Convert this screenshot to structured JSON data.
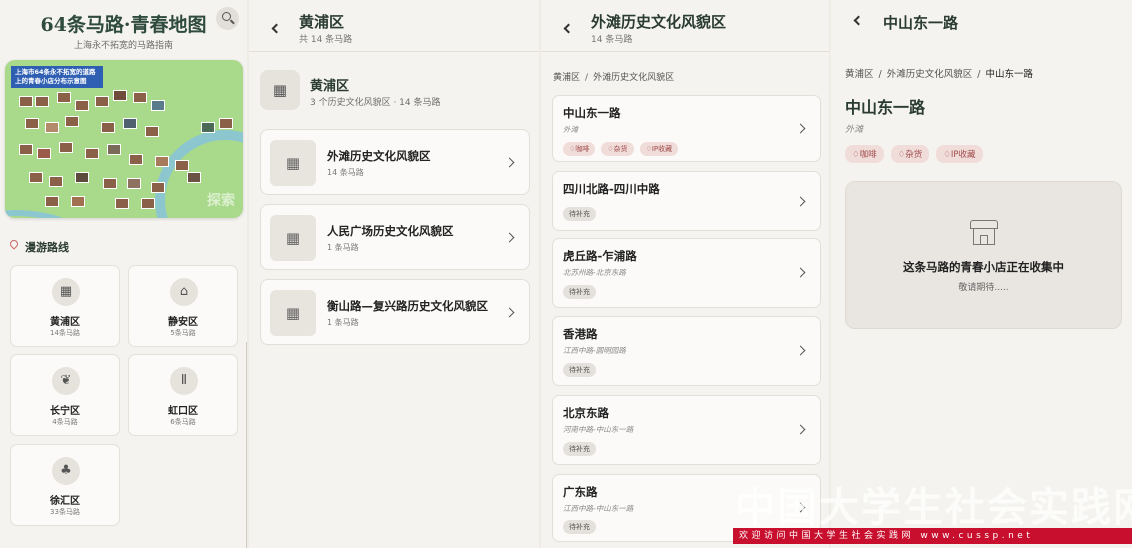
{
  "home": {
    "title": "64条马路·青春地图",
    "subtitle": "上海永不拓宽的马路指南",
    "map_tag": "上海市64条永不拓宽的道路上的青春小店分布示意图",
    "map_watermark": "探索",
    "section_title": "漫游路线",
    "districts": [
      {
        "name": "黄浦区",
        "count": "14条马路",
        "icon": "building-icon"
      },
      {
        "name": "静安区",
        "count": "5条马路",
        "icon": "home-icon"
      },
      {
        "name": "长宁区",
        "count": "4条马路",
        "icon": "leaf-icon"
      },
      {
        "name": "虹口区",
        "count": "6条马路",
        "icon": "pillar-icon"
      },
      {
        "name": "徐汇区",
        "count": "33条马路",
        "icon": "tree-icon"
      }
    ]
  },
  "district": {
    "header_title": "黄浦区",
    "header_sub": "共 14 条马路",
    "title": "黄浦区",
    "summary": "3 个历史文化风貌区 · 14 条马路",
    "areas": [
      {
        "name": "外滩历史文化风貌区",
        "count": "14 条马路"
      },
      {
        "name": "人民广场历史文化风貌区",
        "count": "1 条马路"
      },
      {
        "name": "衡山路—复兴路历史文化风貌区",
        "count": "1 条马路"
      }
    ]
  },
  "area": {
    "header_title": "外滩历史文化风貌区",
    "header_sub": "14 条马路",
    "crumb": [
      "黄浦区",
      "外滩历史文化风貌区"
    ],
    "roads": [
      {
        "name": "中山东一路",
        "near": "外滩",
        "tags": [
          "咖啡",
          "杂货",
          "IP收藏"
        ]
      },
      {
        "name": "四川北路-四川中路",
        "near": "",
        "tags": [
          "待补充"
        ]
      },
      {
        "name": "虎丘路-乍浦路",
        "near": "北苏州路-北京东路",
        "tags": [
          "待补充"
        ]
      },
      {
        "name": "香港路",
        "near": "江西中路-圆明园路",
        "tags": [
          "待补充"
        ]
      },
      {
        "name": "北京东路",
        "near": "河南中路-中山东一路",
        "tags": [
          "待补充"
        ]
      },
      {
        "name": "广东路",
        "near": "江西中路-中山东一路",
        "tags": [
          "待补充"
        ]
      }
    ]
  },
  "road": {
    "header_title": "中山东一路",
    "crumb": [
      "黄浦区",
      "外滩历史文化风貌区",
      "中山东一路"
    ],
    "title": "中山东一路",
    "near": "外滩",
    "tags": [
      "咖啡",
      "杂货",
      "IP收藏"
    ],
    "empty_title": "这条马路的青春小店正在收集中",
    "empty_sub": "敬请期待....."
  },
  "watermark": {
    "big": "中国大学生社会实践网",
    "bar": "欢迎访问中国大学生社会实践网 www.cussp.net"
  },
  "colors": {
    "accent": "#2f4a3e",
    "tag_red": "#a04b4b",
    "bg": "#f5f3ef"
  }
}
